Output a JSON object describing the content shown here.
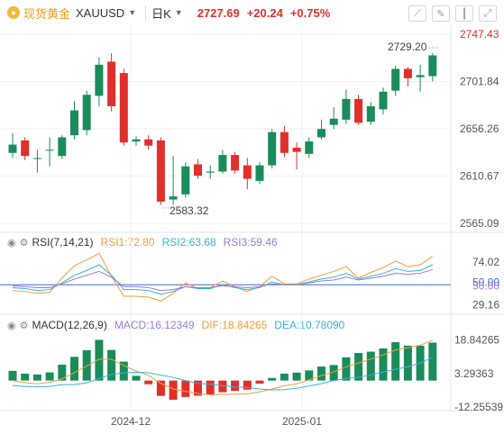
{
  "header": {
    "name": "现货黄金",
    "symbol": "XAUUSD",
    "period": "日K",
    "price": "2727.69",
    "change": "+20.24",
    "change_pct": "+0.75%",
    "tools": [
      "chart-line-icon",
      "draw-icon",
      "candle-icon",
      "fullscreen-icon"
    ]
  },
  "colors": {
    "up": "#1a8c5a",
    "down": "#e0302c",
    "ma1": "#f39c3c",
    "ma2": "#35b4d9",
    "ma3": "#9b7ad8"
  },
  "rsi_legend": {
    "label": "RSI(7,14,21)",
    "rsi1": "RSI1:72.80",
    "rsi2": "RSI2:63.68",
    "rsi3": "RSI3:59.46"
  },
  "macd_legend": {
    "label": "MACD(12,26,9)",
    "macd": "MACD:16.12349",
    "dif": "DIF:18.84265",
    "dea": "DEA:10.78090"
  },
  "chart_data": [
    {
      "type": "candlestick",
      "y_ticks": [
        "2747.43",
        "2701.84",
        "2656.26",
        "2610.67",
        "2565.09"
      ],
      "ylim": [
        2565.09,
        2747.43
      ],
      "x_ticks": [
        "2024-12",
        "2025-01"
      ],
      "annotations": {
        "high": "2729.20",
        "low": "2583.32"
      },
      "candles": [
        {
          "o": 2633,
          "c": 2641,
          "h": 2652,
          "l": 2628
        },
        {
          "o": 2645,
          "c": 2630,
          "h": 2648,
          "l": 2626
        },
        {
          "o": 2628,
          "c": 2628,
          "h": 2636,
          "l": 2614
        },
        {
          "o": 2636,
          "c": 2636,
          "h": 2648,
          "l": 2620
        },
        {
          "o": 2630,
          "c": 2648,
          "h": 2650,
          "l": 2627
        },
        {
          "o": 2650,
          "c": 2674,
          "h": 2683,
          "l": 2646
        },
        {
          "o": 2655,
          "c": 2689,
          "h": 2693,
          "l": 2650
        },
        {
          "o": 2688,
          "c": 2718,
          "h": 2725,
          "l": 2678
        },
        {
          "o": 2721,
          "c": 2678,
          "h": 2729,
          "l": 2673
        },
        {
          "o": 2710,
          "c": 2643,
          "h": 2714,
          "l": 2640
        },
        {
          "o": 2644,
          "c": 2646,
          "h": 2649,
          "l": 2640
        },
        {
          "o": 2646,
          "c": 2640,
          "h": 2650,
          "l": 2636
        },
        {
          "o": 2645,
          "c": 2586,
          "h": 2648,
          "l": 2583
        },
        {
          "o": 2588,
          "c": 2591,
          "h": 2630,
          "l": 2583
        },
        {
          "o": 2593,
          "c": 2620,
          "h": 2624,
          "l": 2590
        },
        {
          "o": 2622,
          "c": 2611,
          "h": 2627,
          "l": 2608
        },
        {
          "o": 2614,
          "c": 2615,
          "h": 2621,
          "l": 2608
        },
        {
          "o": 2615,
          "c": 2631,
          "h": 2636,
          "l": 2613
        },
        {
          "o": 2631,
          "c": 2616,
          "h": 2634,
          "l": 2613
        },
        {
          "o": 2621,
          "c": 2608,
          "h": 2628,
          "l": 2598
        },
        {
          "o": 2606,
          "c": 2621,
          "h": 2624,
          "l": 2603
        },
        {
          "o": 2621,
          "c": 2653,
          "h": 2656,
          "l": 2618
        },
        {
          "o": 2653,
          "c": 2633,
          "h": 2659,
          "l": 2629
        },
        {
          "o": 2638,
          "c": 2634,
          "h": 2643,
          "l": 2617
        },
        {
          "o": 2632,
          "c": 2644,
          "h": 2648,
          "l": 2628
        },
        {
          "o": 2648,
          "c": 2656,
          "h": 2665,
          "l": 2646
        },
        {
          "o": 2660,
          "c": 2666,
          "h": 2677,
          "l": 2656
        },
        {
          "o": 2665,
          "c": 2685,
          "h": 2694,
          "l": 2661
        },
        {
          "o": 2685,
          "c": 2662,
          "h": 2689,
          "l": 2660
        },
        {
          "o": 2663,
          "c": 2678,
          "h": 2682,
          "l": 2660
        },
        {
          "o": 2675,
          "c": 2692,
          "h": 2696,
          "l": 2670
        },
        {
          "o": 2693,
          "c": 2714,
          "h": 2717,
          "l": 2688
        },
        {
          "o": 2714,
          "c": 2705,
          "h": 2716,
          "l": 2697
        },
        {
          "o": 2706,
          "c": 2708,
          "h": 2718,
          "l": 2692
        },
        {
          "o": 2707,
          "c": 2727,
          "h": 2729,
          "l": 2702
        }
      ]
    },
    {
      "type": "line",
      "name": "RSI",
      "y_ticks": [
        "74.02",
        "50.00",
        "50.00",
        "29.16"
      ],
      "ylim": [
        21,
        88
      ],
      "series": [
        {
          "name": "RSI1",
          "values": [
            44,
            43,
            41,
            42,
            57,
            70,
            76,
            83,
            59,
            38,
            38,
            37,
            33,
            41,
            52,
            46,
            47,
            54,
            48,
            43,
            48,
            59,
            51,
            51,
            56,
            60,
            64,
            69,
            57,
            63,
            68,
            75,
            69,
            71,
            80
          ]
        },
        {
          "name": "RSI2",
          "values": [
            47,
            46,
            44,
            45,
            52,
            60,
            65,
            71,
            60,
            45,
            45,
            44,
            40,
            43,
            48,
            46,
            46,
            50,
            47,
            45,
            47,
            53,
            50,
            50,
            53,
            56,
            58,
            62,
            56,
            59,
            62,
            67,
            64,
            65,
            71
          ]
        },
        {
          "name": "RSI3",
          "values": [
            49,
            48,
            47,
            47,
            51,
            56,
            60,
            64,
            58,
            48,
            48,
            47,
            44,
            45,
            48,
            47,
            47,
            49,
            48,
            47,
            48,
            51,
            50,
            50,
            52,
            54,
            55,
            58,
            55,
            57,
            59,
            62,
            61,
            62,
            66
          ]
        }
      ]
    },
    {
      "type": "bar+line",
      "name": "MACD",
      "y_ticks": [
        "18.84265",
        "3.29363",
        "-12.25539"
      ],
      "ylim": [
        -12.26,
        22
      ],
      "histogram": [
        4.5,
        3.2,
        2.8,
        3.8,
        7.4,
        11.0,
        14.1,
        18.9,
        14.2,
        8.8,
        2.2,
        -1.7,
        -7.1,
        -8.9,
        -7.6,
        -7.0,
        -6.6,
        -5.4,
        -4.8,
        -4.2,
        -1.4,
        1.2,
        3.2,
        3.7,
        4.7,
        6.5,
        7.2,
        10.8,
        12.8,
        13.4,
        14.9,
        17.8,
        16.2,
        16.2,
        17.6
      ],
      "dif": [
        0.0,
        -1.0,
        -1.5,
        -0.8,
        0.8,
        3.7,
        6.7,
        10.0,
        9.9,
        7.0,
        4.4,
        2.5,
        -1.3,
        -3.9,
        -5.0,
        -6.0,
        -6.6,
        -6.4,
        -6.3,
        -6.2,
        -5.2,
        -3.9,
        -2.4,
        -1.5,
        0.3,
        2.3,
        4.0,
        6.3,
        8.1,
        10.0,
        11.9,
        14.2,
        15.2,
        16.4,
        18.8
      ],
      "dea": [
        -2.3,
        -2.7,
        -2.9,
        -2.7,
        -1.9,
        -1.8,
        -1.1,
        1.0,
        2.8,
        3.6,
        3.8,
        3.6,
        2.5,
        1.5,
        0.0,
        -1.3,
        -1.7,
        -2.4,
        -3.0,
        -3.2,
        -3.9,
        -4.3,
        -4.2,
        -3.6,
        -2.5,
        -1.4,
        0.0,
        1.0,
        1.5,
        2.6,
        3.9,
        5.3,
        6.4,
        8.1,
        10.8
      ]
    }
  ]
}
